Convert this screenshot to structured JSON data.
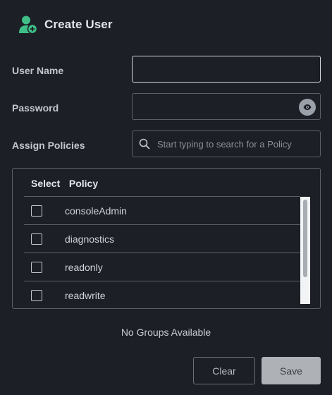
{
  "header": {
    "title": "Create User",
    "icon": "user-add-icon",
    "accent": "#3fbf87"
  },
  "form": {
    "username": {
      "label": "User Name",
      "value": "",
      "placeholder": ""
    },
    "password": {
      "label": "Password",
      "value": "",
      "placeholder": ""
    },
    "policies": {
      "label": "Assign Policies",
      "search_placeholder": "Start typing to search for a Policy"
    }
  },
  "policy_table": {
    "columns": [
      "Select",
      "Policy"
    ],
    "rows": [
      {
        "name": "consoleAdmin",
        "checked": false
      },
      {
        "name": "diagnostics",
        "checked": false
      },
      {
        "name": "readonly",
        "checked": false
      },
      {
        "name": "readwrite",
        "checked": false
      }
    ]
  },
  "groups": {
    "empty_text": "No Groups Available"
  },
  "actions": {
    "clear_label": "Clear",
    "save_label": "Save"
  }
}
